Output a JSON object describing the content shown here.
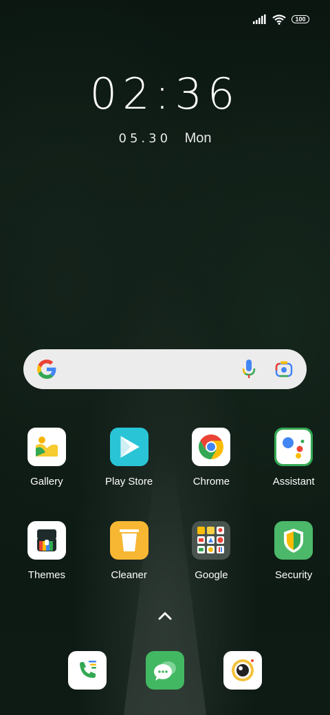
{
  "status_bar": {
    "battery": "100",
    "icons": [
      "signal-icon",
      "wifi-icon",
      "battery-icon"
    ]
  },
  "lock": {
    "time": "02:36",
    "date": "05.30",
    "weekday": "Mon"
  },
  "search": {
    "icons": [
      "google-g-icon",
      "microphone-icon",
      "lens-camera-icon"
    ]
  },
  "apps_row1": [
    {
      "label": "Gallery"
    },
    {
      "label": "Play Store"
    },
    {
      "label": "Chrome"
    },
    {
      "label": "Assistant"
    }
  ],
  "apps_row2": [
    {
      "label": "Themes"
    },
    {
      "label": "Cleaner"
    },
    {
      "label": "Google"
    },
    {
      "label": "Security"
    }
  ],
  "dock": {
    "icons": [
      "phone-app-icon",
      "messages-app-icon",
      "camera-app-icon"
    ]
  },
  "colors": {
    "google_blue": "#4285F4",
    "google_red": "#EA4335",
    "google_yellow": "#FBBC05",
    "google_green": "#34A853",
    "play_teal": "#29C5D6",
    "security_green": "#4CB86A",
    "messages_green": "#43B863"
  }
}
